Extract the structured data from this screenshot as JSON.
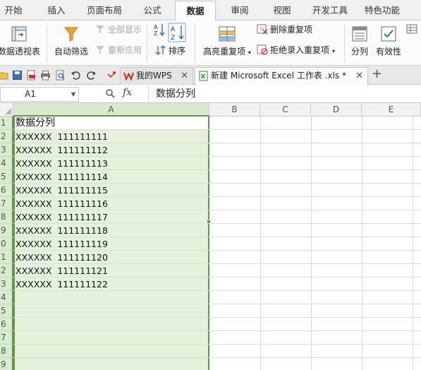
{
  "menu": {
    "tabs": [
      "开始",
      "插入",
      "页面布局",
      "公式",
      "数据",
      "审阅",
      "视图",
      "开发工具",
      "特色功能"
    ],
    "active": "数据"
  },
  "ribbon": {
    "pivot": "数据透视表",
    "autofilter": "自动筛选",
    "show_all": "全部显示",
    "reapply": "重新应用",
    "sort": "排序",
    "highlight_dup": "高亮重复项",
    "remove_dup": "删除重复项",
    "reject_dup": "拒绝录入重复项",
    "split": "分列",
    "validity": "有效性"
  },
  "doc_tabs": {
    "wps": "我的WPS",
    "excel": "新建 Microsoft Excel 工作表 .xls *",
    "add": "+"
  },
  "formula_bar": {
    "name_box": "A1",
    "fx": "fx",
    "content": "数据分列"
  },
  "sheet": {
    "columns": [
      "A",
      "B",
      "C",
      "D",
      "E"
    ],
    "rows": [
      "1",
      "2",
      "3",
      "4",
      "5",
      "6",
      "7",
      "8",
      "9",
      "0",
      "1",
      "2",
      "3",
      "4",
      "5",
      "6",
      "7",
      "8",
      "9"
    ],
    "cells": [
      "数据分列",
      "XXXXXX  111111111",
      "XXXXXX  111111112",
      "XXXXXX  111111113",
      "XXXXXX  111111114",
      "XXXXXX  111111115",
      "XXXXXX  111111116",
      "XXXXXX  111111117",
      "XXXXXX  111111118",
      "XXXXXX  111111119",
      "XXXXXX  111111120",
      "XXXXXX  111111121",
      "XXXXXX  111111122"
    ]
  },
  "colors": {
    "selection": "#5a9b45",
    "selection_fill": "#e4f2dc",
    "wps_red": "#d9322b",
    "excel_green": "#2e8b3a"
  }
}
